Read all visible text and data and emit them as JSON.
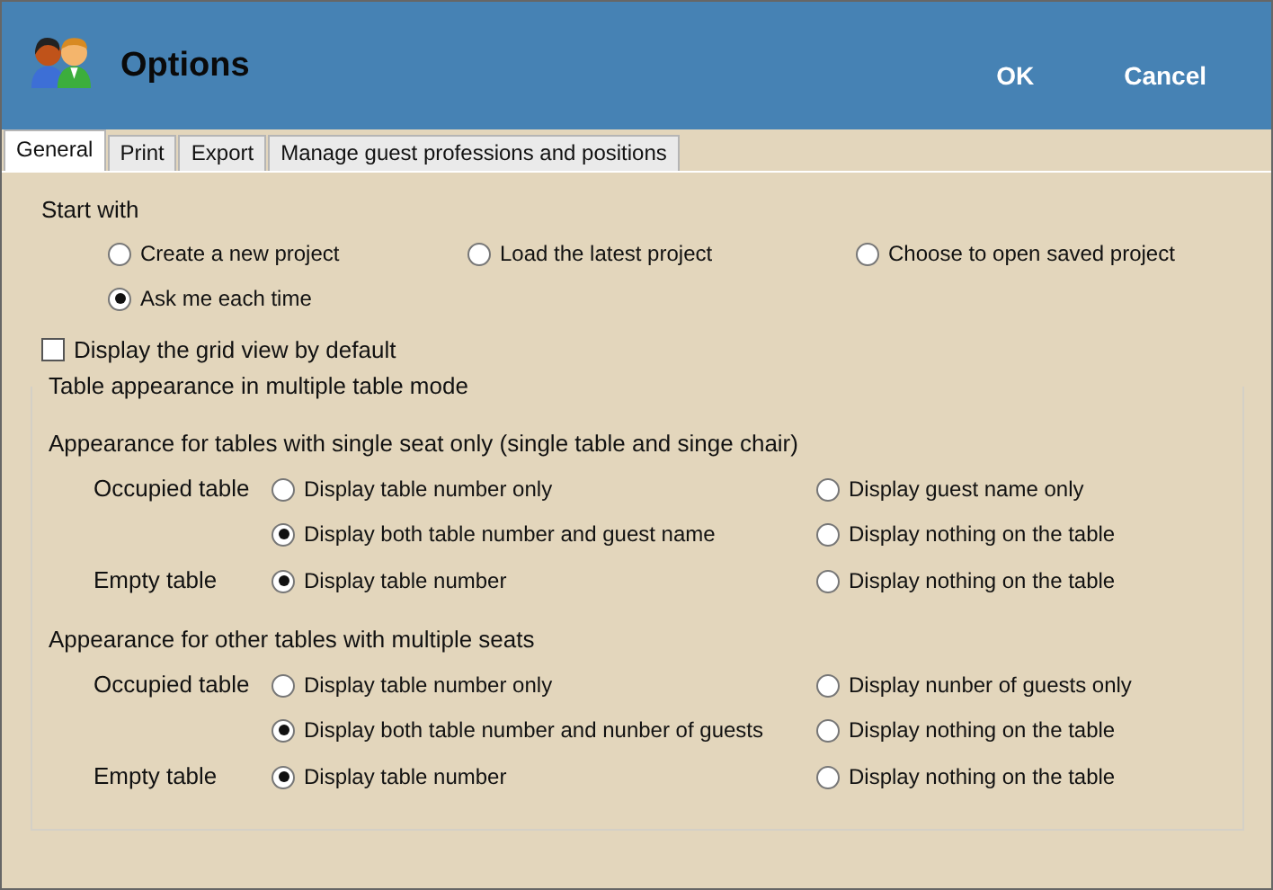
{
  "window": {
    "title": "Options"
  },
  "buttons": [
    "OK",
    "Cancel"
  ],
  "tabs": [
    {
      "label": "General",
      "selected": true
    },
    {
      "label": "Print",
      "selected": false
    },
    {
      "label": "Export",
      "selected": false
    },
    {
      "label": "Manage guest professions and positions",
      "selected": false
    }
  ],
  "start_with": {
    "label": "Start with",
    "options": [
      {
        "label": "Create a new project",
        "selected": false
      },
      {
        "label": "Load the latest project",
        "selected": false
      },
      {
        "label": "Choose to open saved project",
        "selected": false
      },
      {
        "label": "Ask me each time",
        "selected": true
      }
    ]
  },
  "grid_view": {
    "label": "Display the grid view by default",
    "checked": false
  },
  "table_appearance": {
    "title": "Table appearance in multiple table mode",
    "sections": [
      {
        "title": "Appearance for tables with single seat only (single table and singe chair)",
        "rows": [
          {
            "label": "Occupied table",
            "options": [
              {
                "label": "Display table number only",
                "selected": false
              },
              {
                "label": "Display guest name only",
                "selected": false
              },
              {
                "label": "Display both table number and guest name",
                "selected": true
              },
              {
                "label": "Display nothing on the table",
                "selected": false
              }
            ]
          },
          {
            "label": "Empty table",
            "options": [
              {
                "label": "Display table number",
                "selected": true
              },
              {
                "label": "Display nothing on the table",
                "selected": false
              }
            ]
          }
        ]
      },
      {
        "title": "Appearance for other tables with multiple seats",
        "rows": [
          {
            "label": "Occupied table",
            "options": [
              {
                "label": "Display table number only",
                "selected": false
              },
              {
                "label": "Display nunber of guests only",
                "selected": false
              },
              {
                "label": "Display both table number and nunber of guests",
                "selected": true
              },
              {
                "label": "Display nothing on the table",
                "selected": false
              }
            ]
          },
          {
            "label": "Empty table",
            "options": [
              {
                "label": "Display table number",
                "selected": true
              },
              {
                "label": "Display nothing on the table",
                "selected": false
              }
            ]
          }
        ]
      }
    ]
  }
}
